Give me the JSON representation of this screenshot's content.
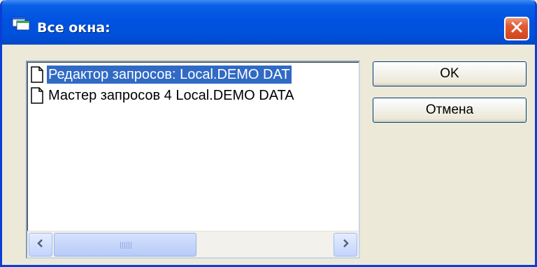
{
  "window": {
    "title": "Все окна:",
    "icon": "windows-list-icon",
    "close_icon": "close-icon"
  },
  "list": {
    "items": [
      {
        "label": "Редактор запросов: Local.DEMO DAT",
        "icon": "document-icon",
        "selected": true
      },
      {
        "label": "Мастер запросов 4 Local.DEMO DATA",
        "icon": "document-icon",
        "selected": false
      }
    ],
    "scrollbar": {
      "left_icon": "arrow-left-icon",
      "right_icon": "arrow-right-icon",
      "position": 0.0,
      "visible_fraction": 0.52
    }
  },
  "buttons": {
    "ok_label": "OK",
    "cancel_label": "Отмена"
  },
  "colors": {
    "titlebar": "#0053e0",
    "selection": "#316ac5",
    "close": "#d2431d",
    "face": "#ece9d8"
  }
}
